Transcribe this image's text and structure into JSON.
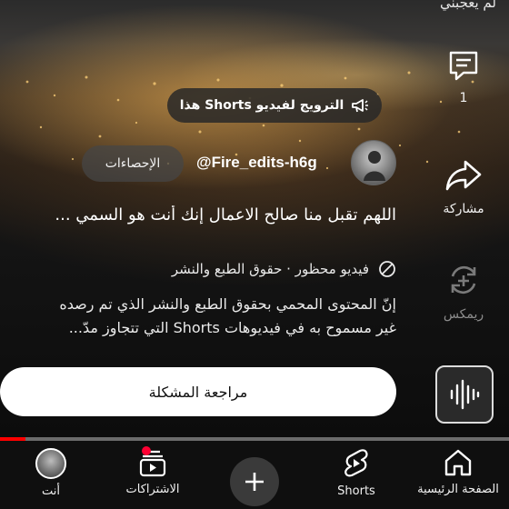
{
  "top_text": "لم يعجبني",
  "promo": {
    "label": "الترويج لفيديو Shorts هذا",
    "icon": "megaphone-icon"
  },
  "channel": {
    "name": "@Fire_edits-h6g",
    "stats_label": "الإحصاءات"
  },
  "video": {
    "title": "اللهم تقبل منا صالح الاعمال إنك أنت هو السمي ...",
    "blocked_notice": "فيديو محظور · حقوق الطبع والنشر",
    "description_line1": "إنّ المحتوى المحمي بحقوق الطبع والنشر الذي تم رصده",
    "description_line2": "غير مسموح به في فيديوهات Shorts التي تتجاوز مدّ...",
    "review_button": "مراجعة المشكلة",
    "progress": 0.05
  },
  "side_actions": {
    "comments_count": "1",
    "share_label": "مشاركة",
    "remix_label": "ريمكس"
  },
  "bottom_nav": {
    "home": "الصفحة الرئيسية",
    "shorts": "Shorts",
    "subscriptions": "الاشتراكات",
    "you": "أنت"
  },
  "colors": {
    "accent": "#ff0000",
    "badge": "#ff0033",
    "nav_bg": "#0f0f0f"
  }
}
